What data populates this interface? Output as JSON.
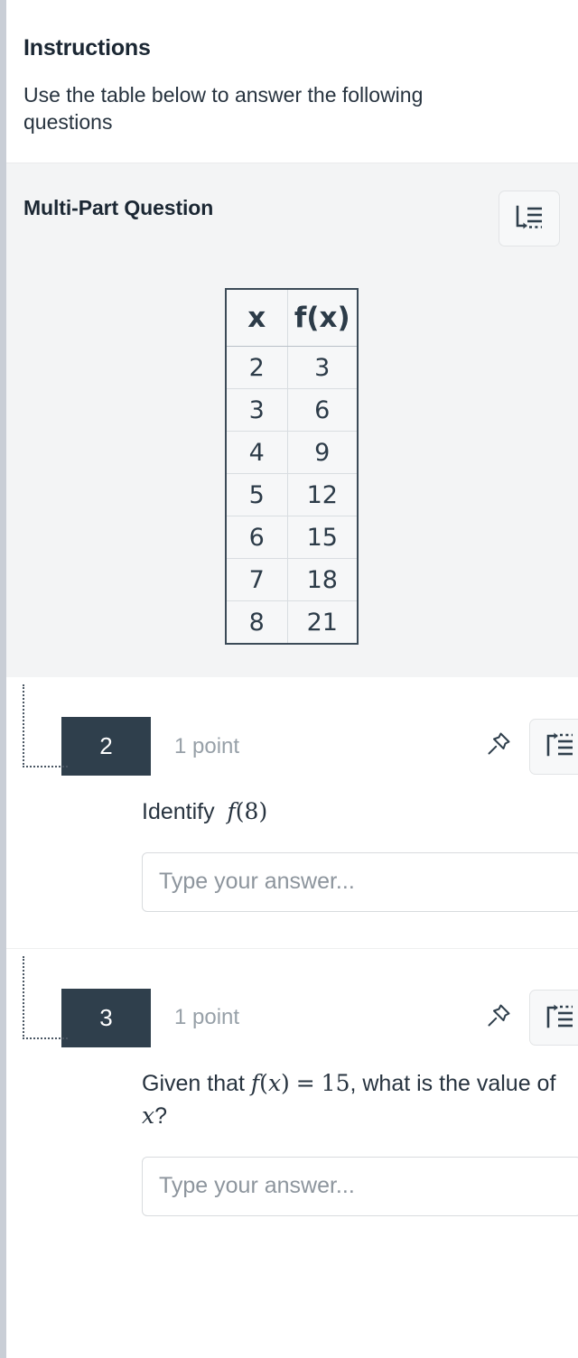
{
  "instructions": {
    "title": "Instructions",
    "body": "Use the table below to answer the following questions"
  },
  "multipart": {
    "title": "Multi-Part Question",
    "icon": "multi-part-question-icon",
    "table": {
      "headers": [
        "x",
        "f(x)"
      ],
      "rows": [
        [
          "2",
          "3"
        ],
        [
          "3",
          "6"
        ],
        [
          "4",
          "9"
        ],
        [
          "5",
          "12"
        ],
        [
          "6",
          "15"
        ],
        [
          "7",
          "18"
        ],
        [
          "8",
          "21"
        ]
      ]
    }
  },
  "subquestions": [
    {
      "number": "2",
      "points": "1 point",
      "pin_icon": "pin-icon",
      "action_icon": "exit-multi-part-icon",
      "prompt_prefix": "Identify",
      "math_f": "f",
      "math_open": "(",
      "math_arg": "8",
      "math_close": ")",
      "answer_placeholder": "Type your answer...",
      "answer_value": ""
    },
    {
      "number": "3",
      "points": "1 point",
      "pin_icon": "pin-icon",
      "action_icon": "exit-multi-part-icon",
      "prompt_prefix": "Given that",
      "math_f": "f",
      "math_open": "(",
      "math_arg": "x",
      "math_close": ")",
      "math_eq": "=",
      "math_value": "15",
      "prompt_middle": ", what is the value of",
      "math_var": "x",
      "prompt_suffix": "?",
      "answer_placeholder": "Type your answer...",
      "answer_value": ""
    }
  ],
  "colors": {
    "badge_bg": "#2f3f4c",
    "points_text": "#97a0a8",
    "section_bg": "#f3f4f5",
    "rail": "#c9ced6",
    "table_border": "#3b4a57"
  }
}
